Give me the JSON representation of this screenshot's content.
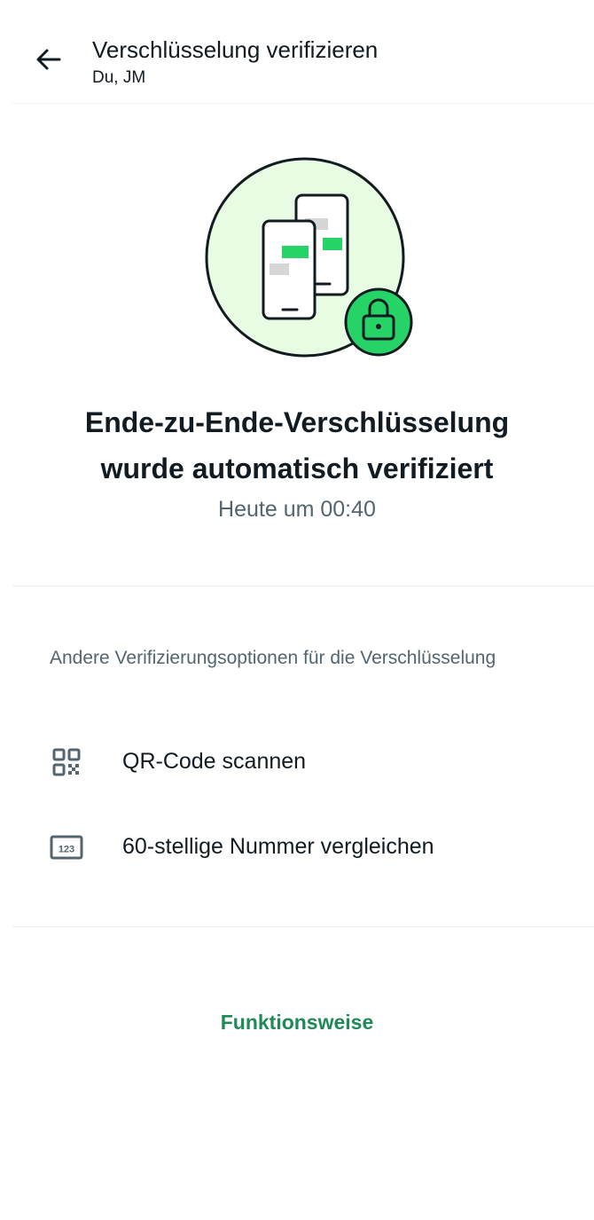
{
  "header": {
    "title": "Verschlüsselung verifizieren",
    "subtitle": "Du, JM",
    "back_icon": "arrow-left-icon"
  },
  "hero": {
    "illustration": "phones-lock-illustration",
    "headline_line1": "Ende-zu-Ende-Verschlüsselung",
    "headline_line2": "wurde automatisch verifiziert",
    "timestamp": "Heute um 00:40"
  },
  "options": {
    "section_title": "Andere Verifizierungsoptionen für die Verschlüsselung",
    "items": [
      {
        "icon": "qr-code-icon",
        "label": "QR-Code scannen"
      },
      {
        "icon": "number-123-icon",
        "label": "60-stellige Nummer vergleichen"
      }
    ]
  },
  "footer": {
    "link_label": "Funktionsweise"
  },
  "colors": {
    "accent": "#1f8a55",
    "bubble_green": "#25d366",
    "circle_fill": "#e7fce3",
    "lock_fill": "#25d366",
    "text_primary": "#111b21",
    "text_secondary": "#54656f",
    "divider": "#e9edef"
  }
}
